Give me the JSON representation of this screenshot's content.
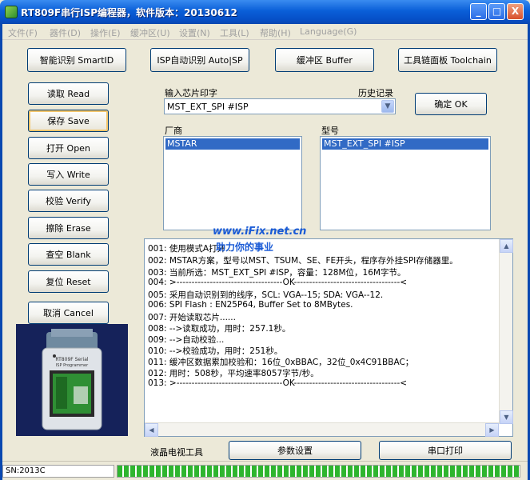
{
  "window": {
    "title": "RT809F串行ISP编程器，软件版本：20130612",
    "minimize_glyph": "_",
    "maximize_glyph": "□",
    "close_glyph": "X"
  },
  "menu": [
    "文件(F)",
    "器件(D)",
    "操作(E)",
    "缓冲区(U)",
    "设置(N)",
    "工具(L)",
    "帮助(H)",
    "Language(G)"
  ],
  "toolbar": {
    "smart_id": "智能识别 SmartID",
    "isp_auto_id": "ISP自动识别 Auto|SP",
    "buffer": "缓冲区 Buffer",
    "toolchain": "工具链面板 Toolchain"
  },
  "side_buttons": {
    "read": "读取 Read",
    "save": "保存 Save",
    "open": "打开 Open",
    "write": "写入 Write",
    "verify": "校验 Verify",
    "erase": "擦除 Erase",
    "blank": "查空 Blank",
    "reset": "复位 Reset",
    "cancel": "取消 Cancel"
  },
  "chip_input": {
    "label": "输入芯片印字",
    "history_label": "历史记录",
    "value": "MST_EXT_SPI #ISP",
    "ok_button": "确定 OK"
  },
  "vendor": {
    "label": "厂商",
    "selected": "MSTAR"
  },
  "model": {
    "label": "型号",
    "selected": "MST_EXT_SPI #ISP"
  },
  "watermark": {
    "site": "www.iFix.net.cn",
    "slogan": "助力你的事业"
  },
  "log_lines": [
    "001: 使用模式A打开...",
    "002: MSTAR方案，型号以MST、TSUM、SE、FE开头，程序存外挂SPI存储器里。",
    "003: 当前所选：MST_EXT_SPI #ISP，容量：128M位，16M字节。",
    "004: >-----------------------------------OK-----------------------------------<",
    "005: 采用自动识别到的线序，SCL: VGA--15; SDA: VGA--12.",
    "006: SPI Flash : EN25P64, Buffer Set to 8MBytes.",
    "007: 开始读取芯片......",
    "008: -->读取成功，用时：257.1秒。",
    "009: -->自动校验...",
    "010: -->校验成功，用时：251秒。",
    "011: 缓冲区数据累加校验和：16位_0xBBAC，32位_0x4C91BBAC；",
    "012: 用时：508秒，平均速率8057字节/秒。",
    "013: >-----------------------------------OK-----------------------------------<"
  ],
  "bottom": {
    "lcd_tools": "液晶电视工具",
    "params": "参数设置",
    "serial_print": "串口打印"
  },
  "statusbar": {
    "sn": "SN:2013C",
    "progress_fraction": 1.0
  },
  "device_photo": {
    "label_line1": "RT809F Serial",
    "label_line2": "ISP Programmer"
  },
  "colors": {
    "title_blue": "#0a5fd8",
    "selection": "#316ac5",
    "progress_green": "#2eb52e",
    "watermark": "#1a5bd6"
  }
}
